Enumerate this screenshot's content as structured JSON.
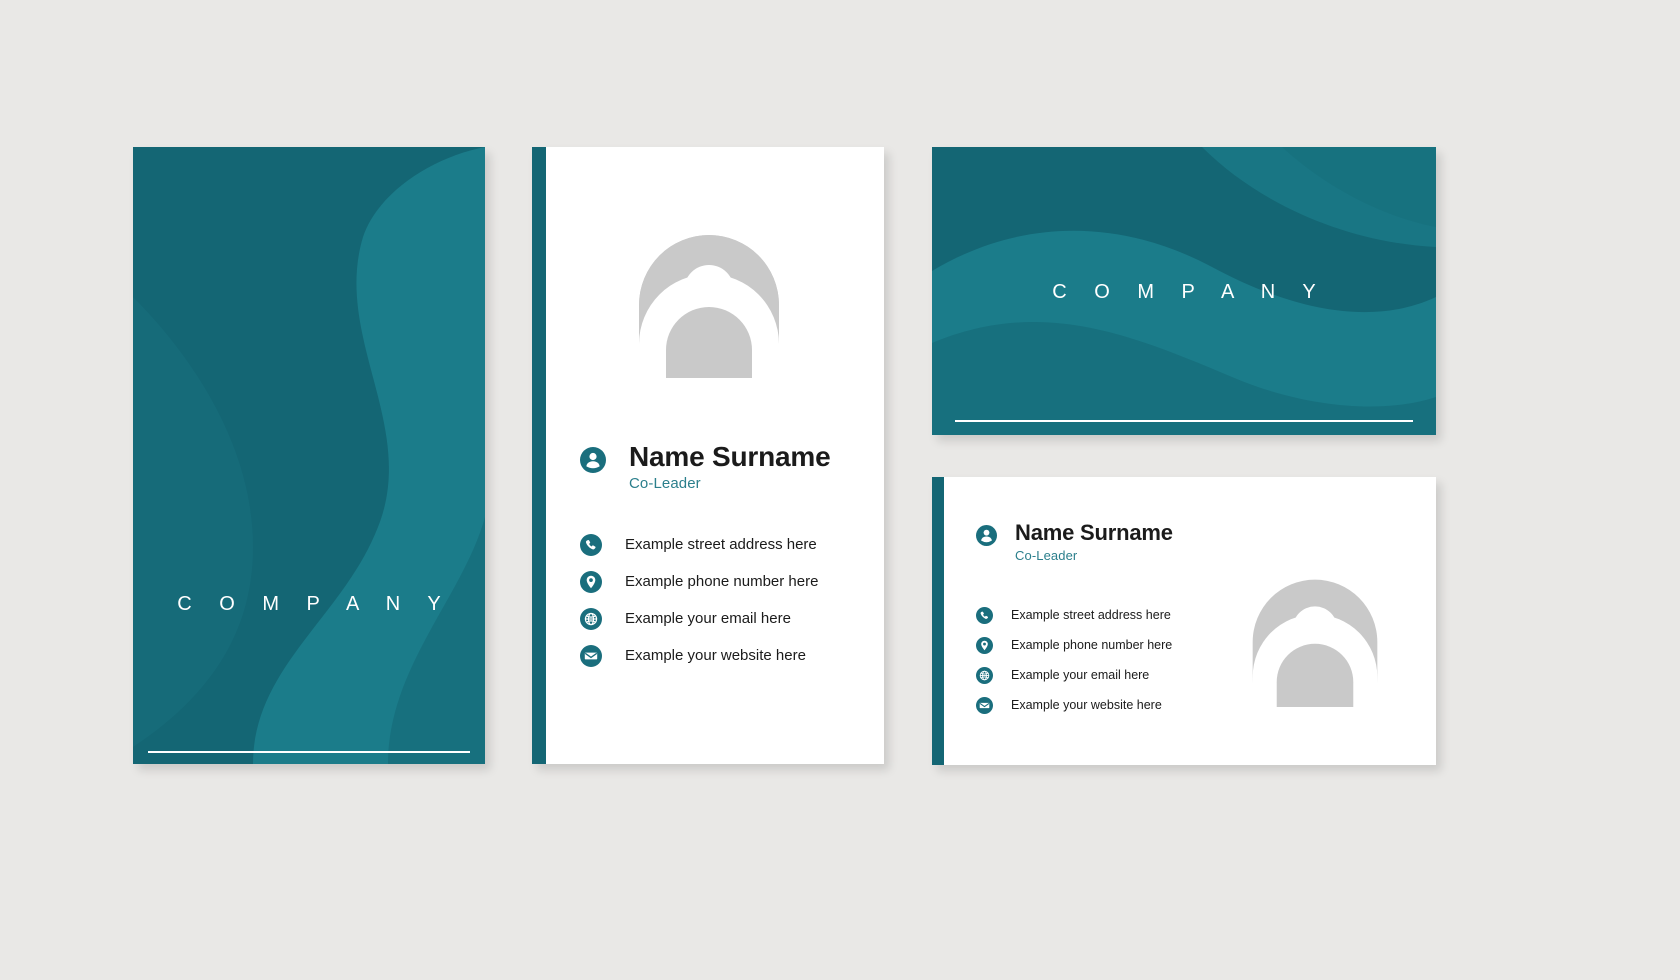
{
  "palette": {
    "page_background": "#e9e8e6",
    "brand_teal": "#146674",
    "wave_teal_light": "#1b7c8a",
    "wave_teal_lighter": "#20808e",
    "accent_text": "#2b7f8c",
    "card_white": "#ffffff",
    "avatar_gray": "#c9c9c9",
    "body_text": "#1b1b1b",
    "rule_white": "#ffffff"
  },
  "brand": {
    "company_word": "C O M P A N Y"
  },
  "person": {
    "name": "Name Surname",
    "role": "Co-Leader"
  },
  "contacts": [
    {
      "icon": "phone-icon",
      "text": "Example street address here"
    },
    {
      "icon": "location-pin-icon",
      "text": "Example phone number here"
    },
    {
      "icon": "globe-icon",
      "text": "Example your email here"
    },
    {
      "icon": "envelope-icon",
      "text": "Example your website here"
    }
  ],
  "cards": {
    "portrait_cover": {
      "name": "portrait-cover-card",
      "orientation": "portrait",
      "style": "teal"
    },
    "portrait_profile": {
      "name": "portrait-profile-card",
      "orientation": "portrait",
      "style": "white"
    },
    "landscape_cover": {
      "name": "landscape-cover-card",
      "orientation": "landscape",
      "style": "teal"
    },
    "landscape_profile": {
      "name": "landscape-profile-card",
      "orientation": "landscape",
      "style": "white"
    }
  },
  "icons": {
    "avatar": "user-avatar-placeholder-icon",
    "person": "person-badge-icon"
  }
}
